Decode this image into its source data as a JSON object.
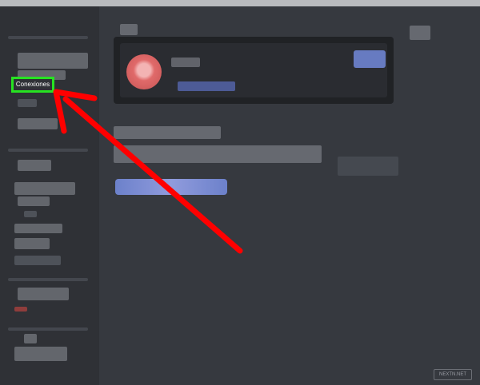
{
  "sidebar": {
    "highlighted_item": {
      "label": "Conexiones"
    }
  },
  "watermark": {
    "text": "NEXTN.NET"
  },
  "colors": {
    "annotation_arrow": "#ff0000",
    "highlight_border": "#27e321",
    "accent": "#7289da"
  },
  "icons": {
    "annotation": "red-arrow-icon"
  }
}
